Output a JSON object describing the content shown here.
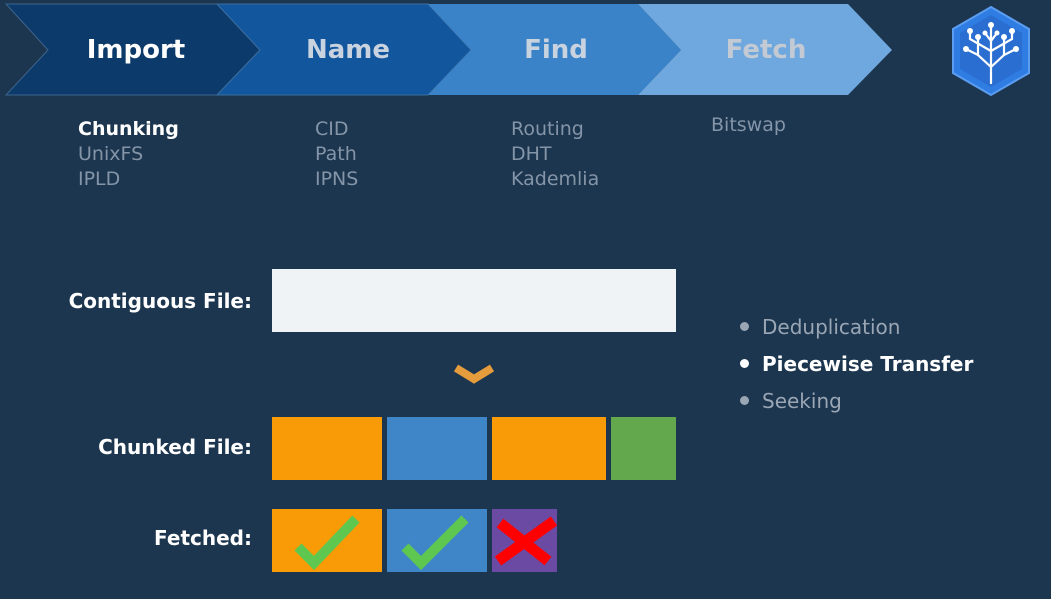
{
  "pipeline": {
    "stages": [
      {
        "label": "Import",
        "color": "#0c3a6b",
        "text_color": "#ffffff"
      },
      {
        "label": "Name",
        "color": "#12569e",
        "text_color": "#c9d3df"
      },
      {
        "label": "Find",
        "color": "#3a83c8",
        "text_color": "#c9d3df"
      },
      {
        "label": "Fetch",
        "color": "#6fa8de",
        "text_color": "#c3cad3"
      }
    ],
    "sub_items": {
      "import": [
        "Chunking",
        "UnixFS",
        "IPLD"
      ],
      "name": [
        "CID",
        "Path",
        "IPNS"
      ],
      "find": [
        "Routing",
        "DHT",
        "Kademlia"
      ],
      "fetch": [
        "Bitswap"
      ]
    },
    "active_sub_item": "Chunking"
  },
  "diagram": {
    "contiguous_label": "Contiguous File:",
    "chunked_label": "Chunked File:",
    "fetched_label": "Fetched:",
    "chunk_colors": [
      "#f99b06",
      "#3f86c9",
      "#f99b06",
      "#64a84d"
    ],
    "fetched_status": [
      "success",
      "success",
      "failed"
    ]
  },
  "benefits": {
    "items": [
      "Deduplication",
      "Piecewise Transfer",
      "Seeking"
    ],
    "active": "Piecewise Transfer"
  },
  "colors": {
    "background": "#1c364f",
    "orange": "#f99b06",
    "blue": "#3f86c9",
    "green": "#64a84d",
    "purple": "#6b4aa3",
    "check": "#5ec750",
    "cross": "#ff0000",
    "arrow": "#e59c3c"
  }
}
